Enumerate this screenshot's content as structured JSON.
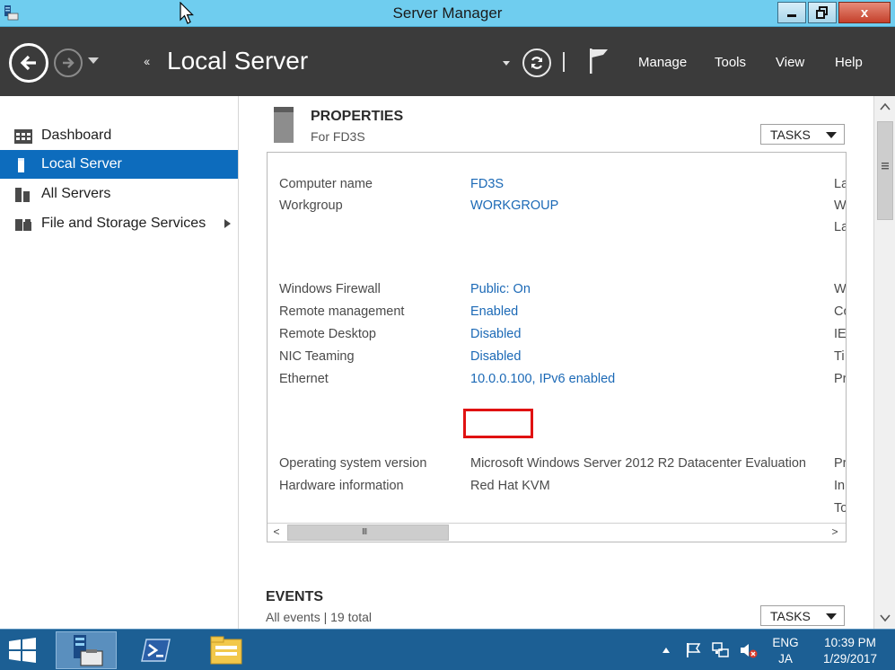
{
  "window": {
    "title": "Server Manager",
    "close_label": "x"
  },
  "header": {
    "breadcrumb_arrows": "‹‹",
    "page_title": "Local Server",
    "menu": [
      "Manage",
      "Tools",
      "View",
      "Help"
    ]
  },
  "sidebar": {
    "items": [
      {
        "label": "Dashboard",
        "icon": "dashboard-icon"
      },
      {
        "label": "Local Server",
        "icon": "local-server-icon",
        "active": true
      },
      {
        "label": "All Servers",
        "icon": "all-servers-icon"
      },
      {
        "label": "File and Storage Services",
        "icon": "file-storage-icon"
      }
    ]
  },
  "properties": {
    "title": "PROPERTIES",
    "subtitle": "For FD3S",
    "tasks_label": "TASKS",
    "rows": [
      {
        "label": "Computer name",
        "value": "FD3S",
        "link": true,
        "clip": "La"
      },
      {
        "label": "Workgroup",
        "value": "WORKGROUP",
        "link": true,
        "clip": "W"
      },
      {
        "label": "",
        "value": "",
        "link": false,
        "clip": "La"
      },
      {
        "label": "Windows Firewall",
        "value": "Public: On",
        "link": true,
        "clip": "W"
      },
      {
        "label": "Remote management",
        "value": "Enabled",
        "link": true,
        "clip": "Co"
      },
      {
        "label": "Remote Desktop",
        "value": "Disabled",
        "link": true,
        "clip": "IE"
      },
      {
        "label": "NIC Teaming",
        "value": "Disabled",
        "link": true,
        "clip": "Ti"
      },
      {
        "label": "Ethernet",
        "value": "10.0.0.100, IPv6 enabled",
        "link": true,
        "clip": "Pr"
      },
      {
        "label": "Operating system version",
        "value": "Microsoft Windows Server 2012 R2 Datacenter Evaluation",
        "link": false,
        "clip": "Pr"
      },
      {
        "label": "Hardware information",
        "value": "Red Hat KVM",
        "link": false,
        "clip": "In"
      },
      {
        "label": "",
        "value": "",
        "link": false,
        "clip": "To"
      }
    ],
    "hscroll_grip": "III"
  },
  "events": {
    "title": "EVENTS",
    "subtitle": "All events | 19 total",
    "tasks_label": "TASKS"
  },
  "taskbar": {
    "apps": [
      "server-manager-app",
      "powershell-app",
      "file-explorer-app"
    ],
    "tray": {
      "language_top": "ENG",
      "language_bottom": "JA",
      "time": "10:39 PM",
      "date": "1/29/2017"
    }
  },
  "colors": {
    "titlebar": "#6fcdef",
    "header": "#3b3b3b",
    "active_item": "#0d6cbd",
    "link": "#1b69b6",
    "highlight": "#e01212",
    "taskbar": "#1c5f94"
  }
}
